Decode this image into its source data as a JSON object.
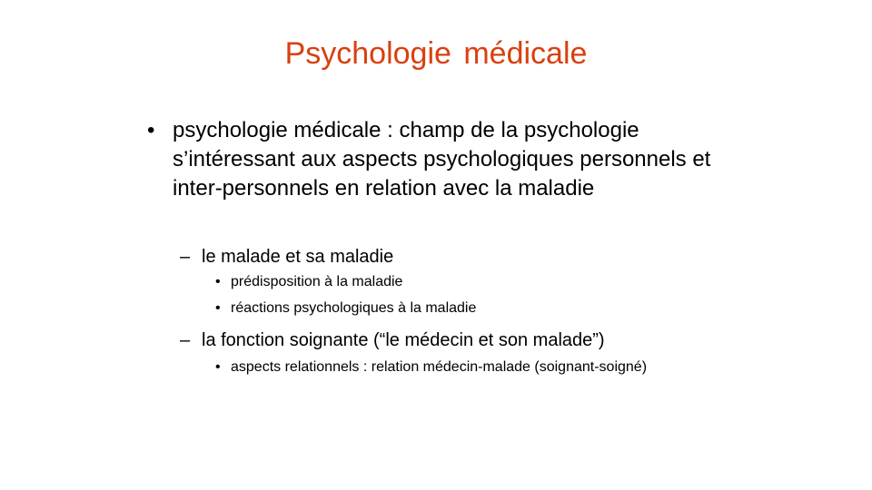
{
  "title": "Psychologie  médicale",
  "bullets": [
    {
      "text": "psychologie médicale : champ de la psychologie s’intéressant aux aspects psychologiques personnels et inter-personnels en relation avec la maladie"
    },
    {
      "text": "le malade et sa maladie"
    },
    {
      "text": "prédisposition à la maladie"
    },
    {
      "text": "réactions psychologiques  à la maladie"
    },
    {
      "text": "la fonction soignante (“le médecin et son malade”)"
    },
    {
      "text": "aspects relationnels  : relation médecin-malade  (soignant-soigné)"
    }
  ],
  "colors": {
    "title": "#D9400F",
    "text": "#000000"
  }
}
